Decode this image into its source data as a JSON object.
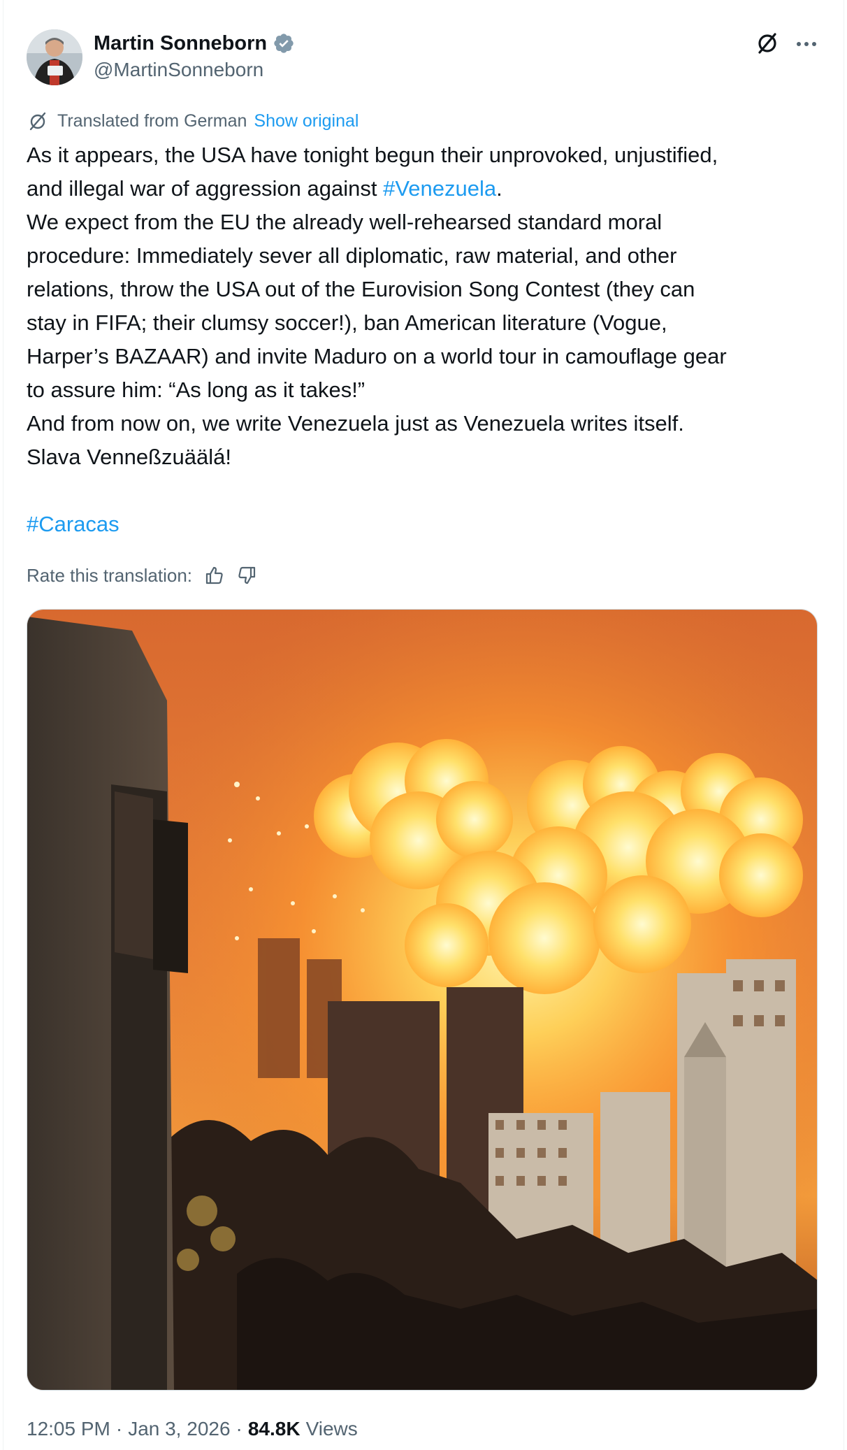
{
  "author": {
    "display_name": "Martin Sonneborn",
    "handle": "@MartinSonneborn",
    "verified": true
  },
  "icons": {
    "verified": "verified-badge-icon",
    "grok": "grok-icon",
    "more": "more-options-icon",
    "translate": "translate-icon",
    "thumbs_up": "thumbs-up-icon",
    "thumbs_down": "thumbs-down-icon"
  },
  "translation": {
    "label": "Translated from German",
    "show_original": "Show original",
    "rate_label": "Rate this translation:"
  },
  "tweet": {
    "lines": [
      "As it appears, the USA have tonight begun their unprovoked, unjustified,",
      "and illegal war of aggression against ",
      "#Venezuela",
      ".",
      "We expect from the EU the already well-rehearsed standard moral",
      "procedure: Immediately sever all diplomatic, raw material, and other",
      "relations, throw the USA out of the Eurovision Song Contest (they can",
      "stay in FIFA; their clumsy soccer!), ban American literature (Vogue,",
      "Harper’s BAZAAR) and invite Maduro on a world tour in camouflage gear",
      "to assure him: “As long as it takes!”",
      "And from now on, we write Venezuela just as Venezuela writes itself.",
      "Slava Venneßzuäälá!"
    ],
    "hashtag_footer": "#Caracas"
  },
  "media": {
    "description_icon": "photo-night-city-explosion"
  },
  "meta": {
    "time": "12:05 PM",
    "separator": "·",
    "date": "Jan 3, 2026",
    "views_count": "84.8K",
    "views_label": "Views"
  },
  "colors": {
    "text": "#0f1419",
    "secondary": "#536471",
    "accent": "#1d9bf0"
  }
}
